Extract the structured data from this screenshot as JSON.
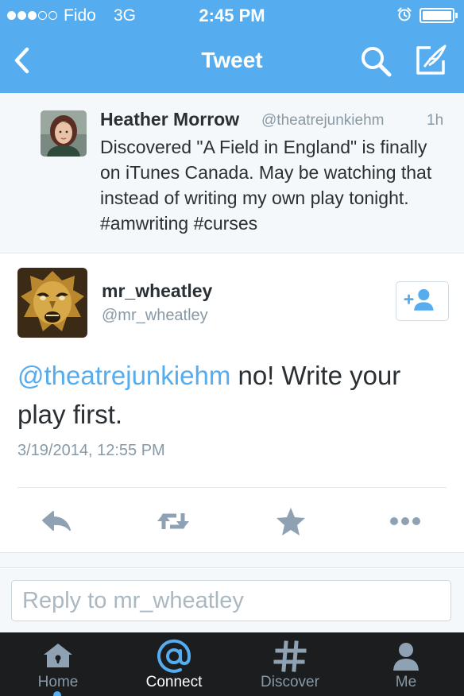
{
  "status_bar": {
    "carrier": "Fido",
    "network": "3G",
    "time": "2:45 PM",
    "signal_bars_filled": 3,
    "signal_bars_total": 5,
    "battery_level": 1.0
  },
  "nav": {
    "title": "Tweet",
    "back_icon": "chevron-left-icon",
    "search_icon": "search-icon",
    "compose_icon": "compose-icon"
  },
  "parent_tweet": {
    "author_name": "Heather Morrow",
    "author_handle": "@theatrejunkiehm",
    "time_ago": "1h",
    "text": "Discovered \"A Field in England\" is finally on iTunes Canada. May be watching that instead of writing my own play tonight. #amwriting #curses"
  },
  "tweet": {
    "author_name": "mr_wheatley",
    "author_handle": "@mr_wheatley",
    "mention": "@theatrejunkiehm",
    "text_rest": " no! Write your play first.",
    "timestamp": "3/19/2014, 12:55 PM",
    "follow_icon": "add-user-icon"
  },
  "actions": [
    {
      "name": "reply",
      "icon": "reply-icon"
    },
    {
      "name": "retweet",
      "icon": "retweet-icon"
    },
    {
      "name": "favorite",
      "icon": "star-icon"
    },
    {
      "name": "more",
      "icon": "more-icon"
    }
  ],
  "reply": {
    "placeholder": "Reply to mr_wheatley",
    "value": ""
  },
  "tabs": [
    {
      "label": "Home",
      "icon": "home-icon",
      "active": false
    },
    {
      "label": "Connect",
      "icon": "at-icon",
      "active": true
    },
    {
      "label": "Discover",
      "icon": "hashtag-icon",
      "active": false
    },
    {
      "label": "Me",
      "icon": "person-icon",
      "active": false
    }
  ],
  "colors": {
    "brand_blue": "#55acee",
    "tab_bar_bg": "#1b1d1f",
    "text_primary": "#292f33",
    "text_secondary": "#8899a6",
    "action_icon": "#8ea2b4"
  }
}
